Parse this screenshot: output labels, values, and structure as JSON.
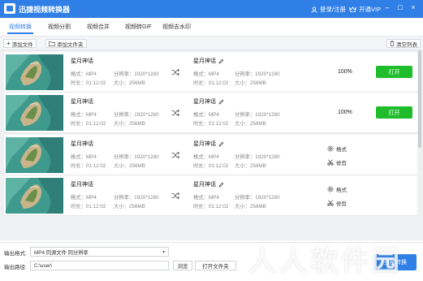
{
  "app": {
    "title": "迅捷视频转换器"
  },
  "titlebar": {
    "login": "登录/注册",
    "vip": "开通VIP"
  },
  "tabs": [
    "视频转换",
    "视频分割",
    "视频合并",
    "视频转GIF",
    "视频去水印"
  ],
  "toolbar": {
    "add_file": "添加文件",
    "add_folder": "添加文件夹",
    "clear_list": "清空列表"
  },
  "list": {
    "rows": [
      {
        "name": "星月神话",
        "format_label": "格式：",
        "format": "MP4",
        "resolution_label": "分辨率：",
        "resolution": "1920*1280",
        "duration_label": "时长：",
        "duration": "01:12:02",
        "size_label": "大小：",
        "size": "256MB",
        "out_name": "星月神话",
        "out_format": "MP4",
        "out_resolution": "1920*1280",
        "out_duration": "01:12:02",
        "out_size": "256MB",
        "progress": "100%",
        "open_label": "打开"
      },
      {
        "name": "星月神话",
        "format_label": "格式：",
        "format": "MP4",
        "resolution_label": "分辨率：",
        "resolution": "1920*1280",
        "duration_label": "时长：",
        "duration": "01:12:02",
        "size_label": "大小：",
        "size": "256MB",
        "out_name": "星月神话",
        "out_format": "MP4",
        "out_resolution": "1920*1280",
        "out_duration": "01:12:02",
        "out_size": "256MB",
        "progress": "100%",
        "open_label": "打开"
      },
      {
        "name": "星月神话",
        "format_label": "格式：",
        "format": "MP4",
        "resolution_label": "分辨率：",
        "resolution": "1920*1280",
        "duration_label": "时长：",
        "duration": "01:12:02",
        "size_label": "大小：",
        "size": "256MB",
        "out_name": "星月神话",
        "out_format": "MP4",
        "out_resolution": "1920*1280",
        "out_duration": "01:12:02",
        "out_size": "256MB",
        "format_action": "格式",
        "trim_action": "修剪"
      },
      {
        "name": "星月神话",
        "format_label": "格式：",
        "format": "MP4",
        "resolution_label": "分辨率：",
        "resolution": "1920*1280",
        "duration_label": "时长：",
        "duration": "01:12:02",
        "size_label": "大小：",
        "size": "256MB",
        "out_name": "星月神话",
        "out_format": "MP4",
        "out_resolution": "1920*1280",
        "out_duration": "01:12:02",
        "out_size": "256MB",
        "format_action": "格式",
        "trim_action": "修剪"
      }
    ]
  },
  "bottom": {
    "output_format_label": "输出格式:",
    "output_format_value": "MP4  同源文件  同分辨率",
    "output_path_label": "输出路径:",
    "output_path_value": "C:\\user\\",
    "browse": "浏览",
    "open_folder": "打开文件夹",
    "convert_all": "全部转换"
  },
  "watermark": "人人软件园",
  "colors": {
    "brand_blue": "#2f7fe6",
    "open_green": "#1fbd2b"
  },
  "icons": [
    "app-logo-icon",
    "user-icon",
    "vip-icon",
    "minimize-icon",
    "maximize-icon",
    "close-icon",
    "plus-icon",
    "folder-icon",
    "trash-icon",
    "edit-icon",
    "shuffle-icon",
    "gear-icon",
    "scissors-icon"
  ]
}
